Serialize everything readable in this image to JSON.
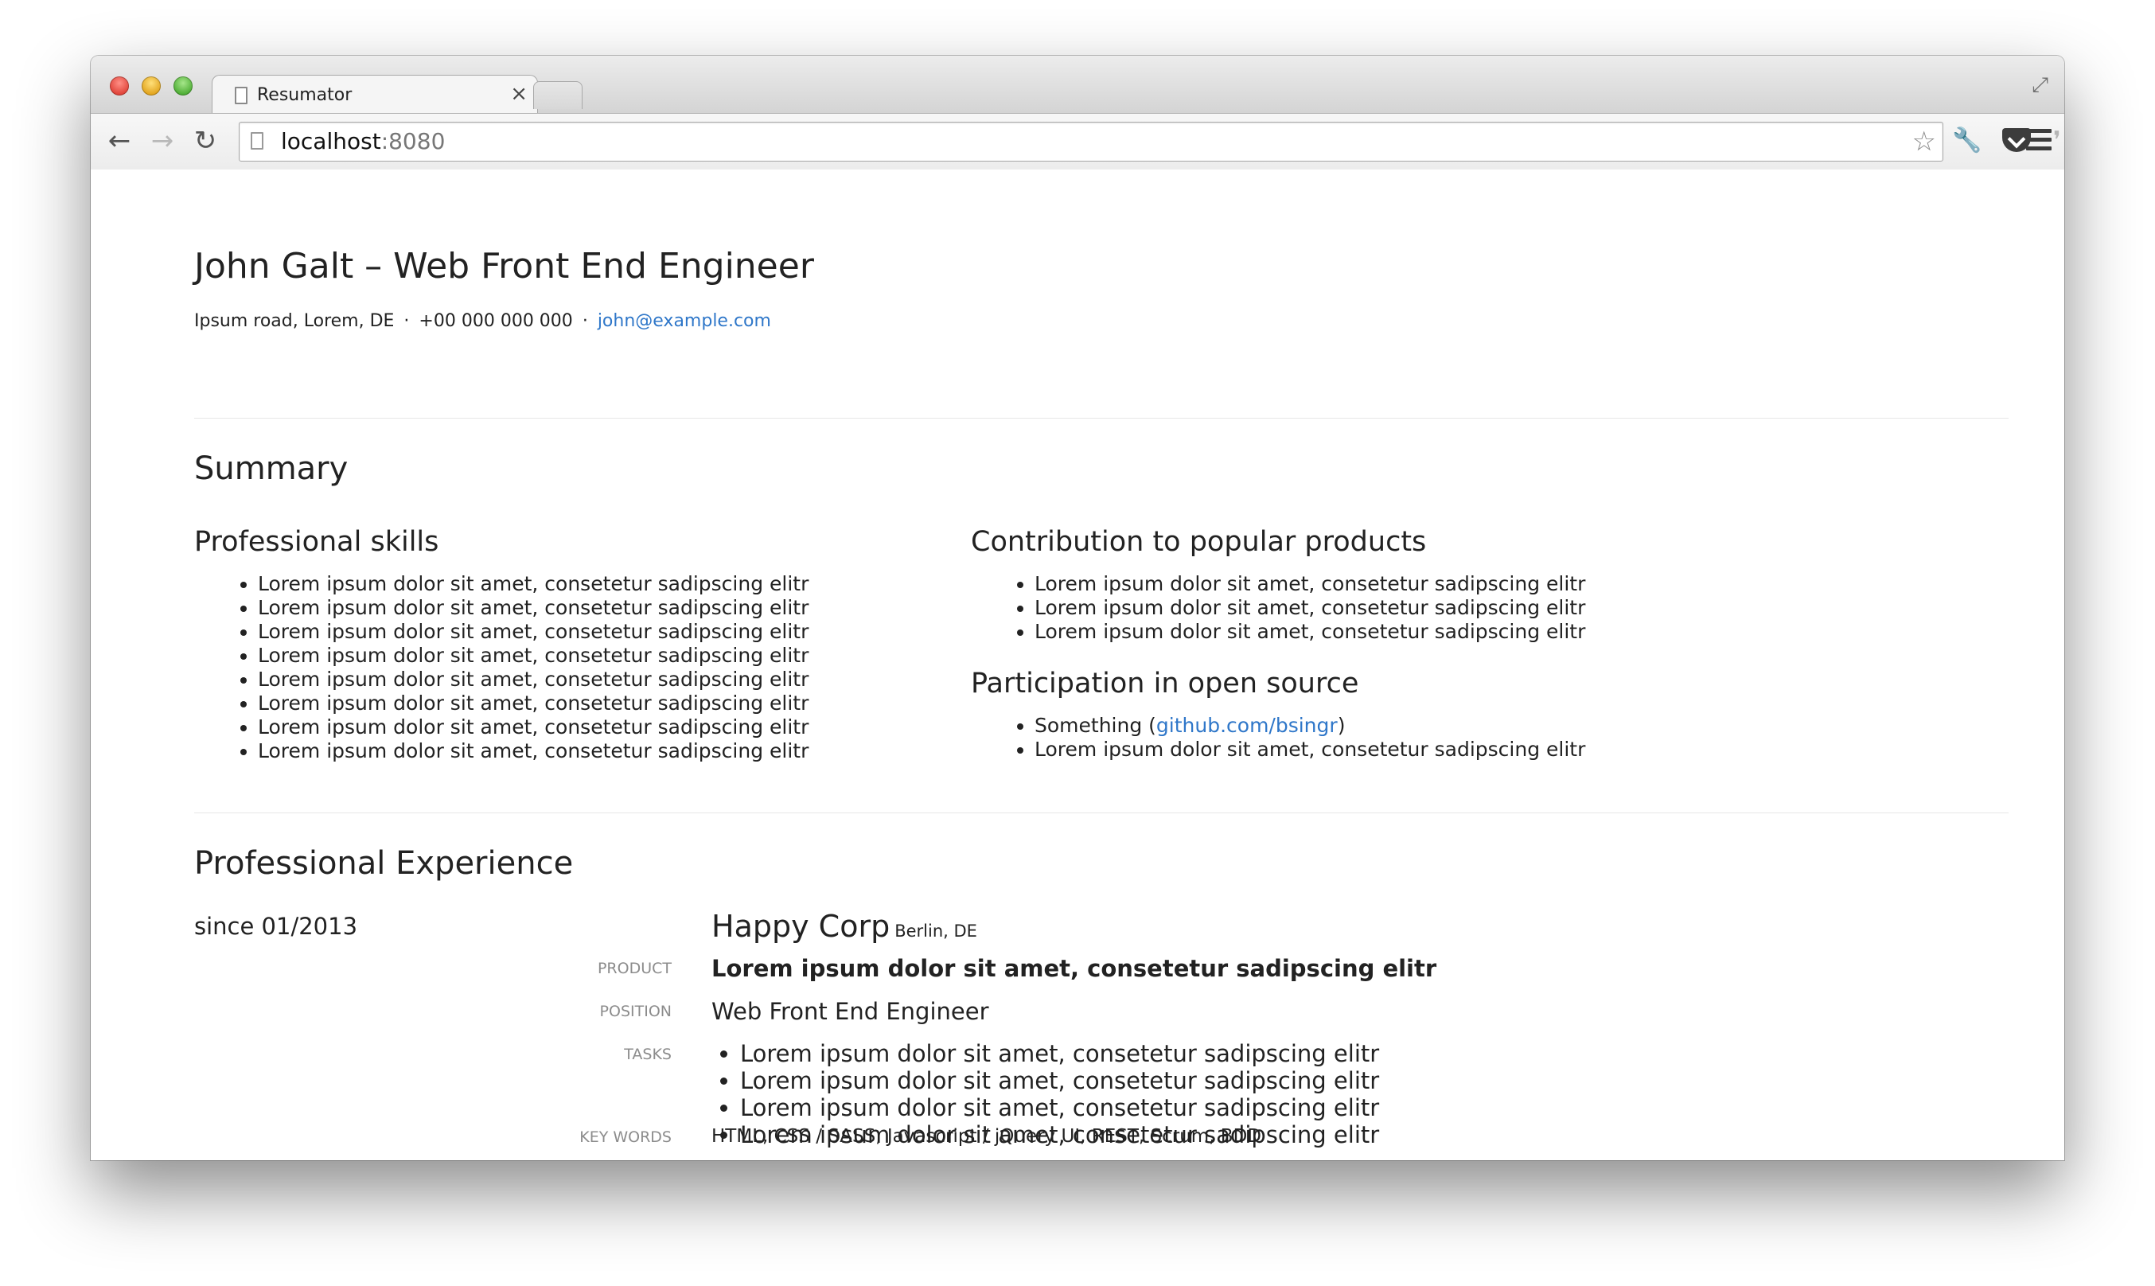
{
  "browser": {
    "tab_title": "Resumator",
    "tab_close": "×",
    "url_host": "localhost",
    "url_port": ":8080",
    "icons": {
      "back": "←",
      "forward": "→",
      "reload": "↻",
      "star": "☆",
      "wrench": "🔧",
      "pocket": "pocket-icon",
      "extension": "❜",
      "menu": "menu-icon",
      "fullscreen": "⤢"
    }
  },
  "resume": {
    "name_title": "John Galt – Web Front End Engineer",
    "contact": {
      "address": "Ipsum road, Lorem, DE",
      "separator": "·",
      "phone": "+00 000 000 000",
      "email": "john@example.com"
    },
    "summary": {
      "heading": "Summary",
      "skills": {
        "heading": "Professional skills",
        "items": [
          "Lorem ipsum dolor sit amet, consetetur sadipscing elitr",
          "Lorem ipsum dolor sit amet, consetetur sadipscing elitr",
          "Lorem ipsum dolor sit amet, consetetur sadipscing elitr",
          "Lorem ipsum dolor sit amet, consetetur sadipscing elitr",
          "Lorem ipsum dolor sit amet, consetetur sadipscing elitr",
          "Lorem ipsum dolor sit amet, consetetur sadipscing elitr",
          "Lorem ipsum dolor sit amet, consetetur sadipscing elitr",
          "Lorem ipsum dolor sit amet, consetetur sadipscing elitr"
        ]
      },
      "contribution": {
        "heading": "Contribution to popular products",
        "items": [
          "Lorem ipsum dolor sit amet, consetetur sadipscing elitr",
          "Lorem ipsum dolor sit amet, consetetur sadipscing elitr",
          "Lorem ipsum dolor sit amet, consetetur sadipscing elitr"
        ]
      },
      "open_source": {
        "heading": "Participation in open source",
        "item1_text": "Something (",
        "item1_link": "github.com/bsingr",
        "item1_close": ")",
        "item2": "Lorem ipsum dolor sit amet, consetetur sadipscing elitr"
      }
    },
    "experience": {
      "heading": "Professional Experience",
      "since": "since 01/2013",
      "company": "Happy Corp",
      "location": "Berlin, DE",
      "product_label": "Product",
      "product": "Lorem ipsum dolor sit amet, consetetur sadipscing elitr",
      "position_label": "Position",
      "position": "Web Front End Engineer",
      "tasks_label": "Tasks",
      "tasks": [
        "Lorem ipsum dolor sit amet, consetetur sadipscing elitr",
        "Lorem ipsum dolor sit amet, consetetur sadipscing elitr",
        "Lorem ipsum dolor sit amet, consetetur sadipscing elitr",
        "Lorem ipsum dolor sit amet, consetetur sadipscing elitr"
      ],
      "keywords_label": "Key words",
      "keywords": "HTML, CSS / SASS, Javascript / jQuery UI, REST, Scrum, BDD"
    }
  }
}
